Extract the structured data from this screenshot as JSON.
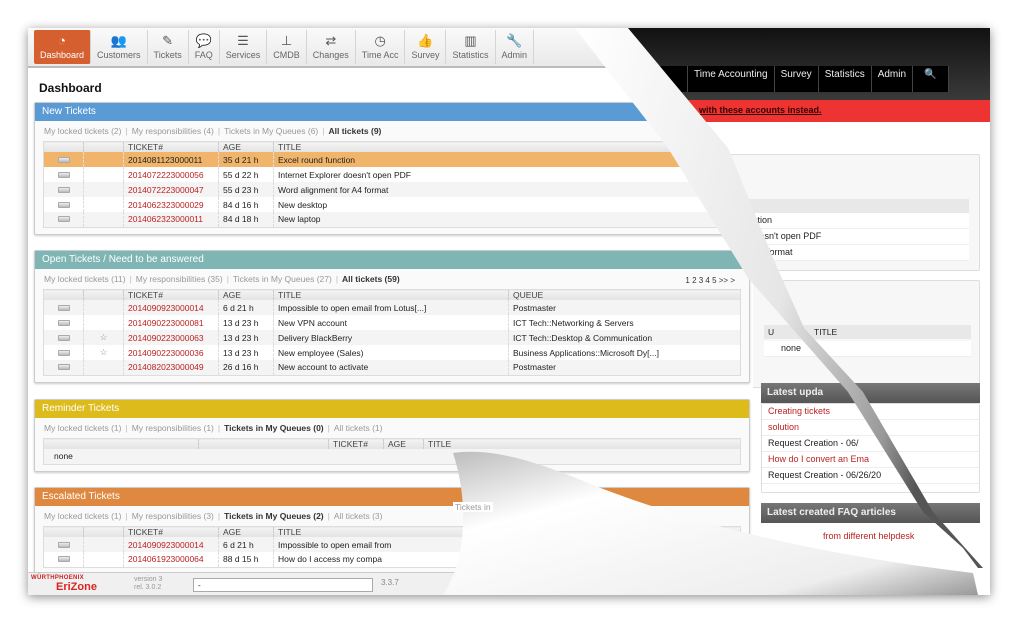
{
  "nav": [
    {
      "label": "Dashboard",
      "icon": "dashboard-icon",
      "glyph": "◔",
      "active": true
    },
    {
      "label": "Customers",
      "icon": "users-icon",
      "glyph": "👥"
    },
    {
      "label": "Tickets",
      "icon": "ticket-icon",
      "glyph": "✎"
    },
    {
      "label": "FAQ",
      "icon": "comments-icon",
      "glyph": "💬"
    },
    {
      "label": "Services",
      "icon": "list-icon",
      "glyph": "☰"
    },
    {
      "label": "CMDB",
      "icon": "sitemap-icon",
      "glyph": "⊥"
    },
    {
      "label": "Changes",
      "icon": "retweet-icon",
      "glyph": "⇄"
    },
    {
      "label": "Time Acc",
      "icon": "clock-icon",
      "glyph": "◷"
    },
    {
      "label": "Survey",
      "icon": "thumbs-up-icon",
      "glyph": "👍"
    },
    {
      "label": "Statistics",
      "icon": "bar-chart-icon",
      "glyph": "▥"
    },
    {
      "label": "Admin",
      "icon": "wrench-icon",
      "glyph": "🔧"
    }
  ],
  "page_title": "Dashboard",
  "colors": {
    "new": "#5b9bd5",
    "open": "#7fb5b5",
    "reminder": "#ddbb1a",
    "escalated": "#df8840",
    "active_nav": "#d65f2f",
    "ticket_link": "#b22222",
    "alert": "#ee3333"
  },
  "widgets": [
    {
      "title": "New Tickets",
      "filters": [
        {
          "t": "My locked tickets (2)"
        },
        {
          "t": "My responsibilities (4)"
        },
        {
          "t": "Tickets in My Queues (6)"
        },
        {
          "t": "All tickets (9)",
          "active": true
        }
      ],
      "columns": [
        "",
        "",
        "TICKET#",
        "AGE",
        "TITLE"
      ],
      "rows": [
        [
          "",
          "",
          "2014081123000011",
          "35 d 21 h",
          "Excel round function"
        ],
        [
          "",
          "",
          "2014072223000056",
          "55 d 22 h",
          "Internet Explorer doesn't open PDF"
        ],
        [
          "",
          "",
          "2014072223000047",
          "55 d 23 h",
          "Word alignment for A4 format"
        ],
        [
          "",
          "",
          "2014062323000029",
          "84 d 16 h",
          "New desktop"
        ],
        [
          "",
          "",
          "2014062323000011",
          "84 d 18 h",
          "New laptop"
        ]
      ],
      "highlight": 0
    },
    {
      "title": "Open Tickets / Need to be answered",
      "filters": [
        {
          "t": "My locked tickets (11)"
        },
        {
          "t": "My responsibilities (35)"
        },
        {
          "t": "Tickets in My Queues (27)"
        },
        {
          "t": "All tickets (59)",
          "active": true
        }
      ],
      "pager": "1 2 3 4 5 >> >",
      "columns": [
        "",
        "",
        "TICKET#",
        "AGE",
        "TITLE",
        "QUEUE"
      ],
      "rows": [
        [
          "",
          "",
          "2014090923000014",
          "6 d 21 h",
          "Impossible to open email from Lotus[...]",
          "Postmaster"
        ],
        [
          "",
          "",
          "2014090223000081",
          "13 d 23 h",
          "New VPN account",
          "ICT Tech::Networking & Servers"
        ],
        [
          "",
          "☆",
          "2014090223000063",
          "13 d 23 h",
          "Delivery BlackBerry",
          "ICT Tech::Desktop & Communication"
        ],
        [
          "",
          "☆",
          "2014090223000036",
          "13 d 23 h",
          "New employee (Sales)",
          "Business Applications::Microsoft Dy[...]"
        ],
        [
          "",
          "",
          "2014082023000049",
          "26 d 16 h",
          "New account to activate",
          "Postmaster"
        ]
      ]
    },
    {
      "title": "Reminder Tickets",
      "filters": [
        {
          "t": "My locked tickets (1)"
        },
        {
          "t": "My responsibilities (1)"
        },
        {
          "t": "Tickets in My Queues (0)",
          "active": true
        },
        {
          "t": "All tickets (1)"
        }
      ],
      "columns": [
        "",
        "",
        "TICKET#",
        "AGE",
        "TITLE"
      ],
      "empty": "none",
      "rows": []
    },
    {
      "title": "Escalated Tickets",
      "filters": [
        {
          "t": "My locked tickets (1)"
        },
        {
          "t": "My responsibilities (3)"
        },
        {
          "t": "Tickets in My Queues (2)",
          "active": true
        },
        {
          "t": "All tickets (3)"
        }
      ],
      "columns": [
        "",
        "",
        "TICKET#",
        "AGE",
        "TITLE"
      ],
      "rows": [
        [
          "",
          "",
          "2014090923000014",
          "6 d 21 h",
          "Impossible to open email from"
        ],
        [
          "",
          "",
          "2014061923000064",
          "88 d 15 h",
          "How do I access my compa"
        ]
      ]
    }
  ],
  "footer": {
    "logo_top": "WÜRTHPHOENIX",
    "logo_main": "EriZone",
    "version": "version 3",
    "release": "rel. 3.0.2",
    "input_value": "-",
    "otrs_version": "3.3.7"
  },
  "under_page": {
    "nav": [
      "Time Accounting",
      "Survey",
      "Statistics",
      "Admin"
    ],
    "alert": "with these accounts instead.",
    "panel1_rows": [
      "l function",
      "rer doesn't open PDF",
      "t for A4 format"
    ],
    "panel2_header": [
      "U",
      "TITLE"
    ],
    "panel2_empty": "none",
    "latest_updated": "Latest upda",
    "latest_rows": [
      {
        "t": "Creating tickets",
        "link": true
      },
      {
        "t": "solution",
        "link": true
      },
      {
        "t": "Request Creation - 06/"
      },
      {
        "t": "How do I convert an Ema",
        "link": true
      },
      {
        "t": "Request Creation - 06/26/20"
      }
    ],
    "latest_faq": "Latest created FAQ articles",
    "faq_row": "from different helpdesk",
    "tickets_in": "Tickets in"
  }
}
